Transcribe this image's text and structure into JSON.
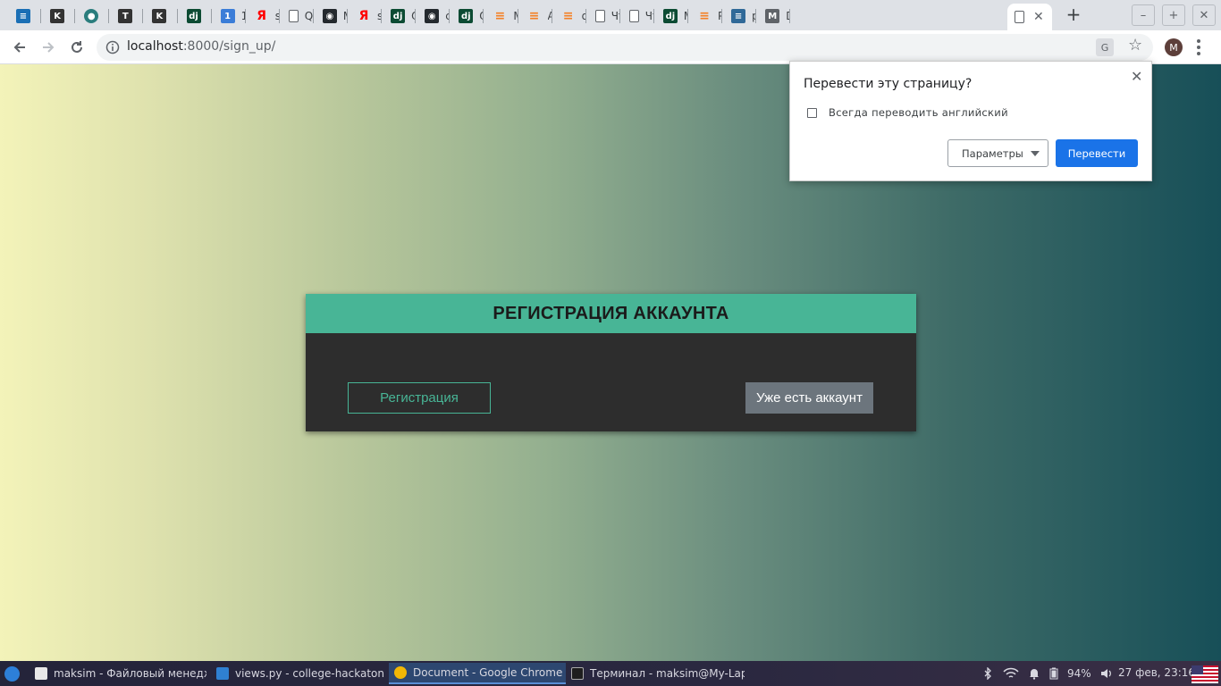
{
  "browser": {
    "tabs": [
      {
        "icon": "drive-icon",
        "icon_color": "#1a6fb5",
        "title": ""
      },
      {
        "icon": "k-icon",
        "icon_color": "#333333",
        "title": ""
      },
      {
        "icon": "circle-icon",
        "icon_color": "#2a7d7d",
        "title": ""
      },
      {
        "icon": "t-icon",
        "icon_color": "#333333",
        "title": ""
      },
      {
        "icon": "k-icon",
        "icon_color": "#333333",
        "title": ""
      },
      {
        "icon": "django-icon",
        "icon_color": "#0c4b33",
        "title": ""
      },
      {
        "icon": "one-icon",
        "icon_color": "#3b7dd8",
        "title": "1 г"
      },
      {
        "icon": "yandex-icon",
        "icon_color": "#ff0000",
        "title": "se"
      },
      {
        "icon": "page-icon",
        "icon_color": "#5f6368",
        "title": "Qt"
      },
      {
        "icon": "github-icon",
        "icon_color": "#24292e",
        "title": "Ma"
      },
      {
        "icon": "yandex-icon",
        "icon_color": "#ff0000",
        "title": "se"
      },
      {
        "icon": "django-icon",
        "icon_color": "#0c4b33",
        "title": "Qt"
      },
      {
        "icon": "github-icon",
        "icon_color": "#24292e",
        "title": "co"
      },
      {
        "icon": "django-icon",
        "icon_color": "#0c4b33",
        "title": "Qt"
      },
      {
        "icon": "stackoverflow-icon",
        "icon_color": "#f48024",
        "title": "Mo"
      },
      {
        "icon": "stackoverflow-icon",
        "icon_color": "#f48024",
        "title": "Al"
      },
      {
        "icon": "stackoverflow-icon",
        "icon_color": "#f48024",
        "title": "dja"
      },
      {
        "icon": "page-icon",
        "icon_color": "#5f6368",
        "title": "Чт"
      },
      {
        "icon": "page-icon",
        "icon_color": "#5f6368",
        "title": "Чт"
      },
      {
        "icon": "django-icon",
        "icon_color": "#0c4b33",
        "title": "Ma"
      },
      {
        "icon": "stackoverflow-icon",
        "icon_color": "#f48024",
        "title": "Py"
      },
      {
        "icon": "python-icon",
        "icon_color": "#306998",
        "title": "py"
      },
      {
        "icon": "gmail-icon",
        "icon_color": "#5f6368",
        "title": "Dj"
      }
    ],
    "active_tab": {
      "icon": "page-icon",
      "title": ""
    },
    "new_tab_symbol": "+",
    "window_buttons": {
      "minimize": "–",
      "maximize": "+",
      "close": "✕"
    },
    "url_host": "localhost",
    "url_rest": ":8000/sign_up/",
    "avatar_letter": "M"
  },
  "page": {
    "card_title": "РЕГИСТРАЦИЯ АККАУНТА",
    "register_button": "Регистрация",
    "login_button": "Уже есть аккаунт",
    "colors": {
      "accent": "#48b596",
      "card_bg": "#2d2d2d",
      "secondary_button": "#6c757d"
    }
  },
  "translate_popup": {
    "title": "Перевести эту страницу?",
    "checkbox_label": "Всегда переводить английский",
    "checkbox_checked": false,
    "options_button": "Параметры",
    "translate_button": "Перевести",
    "accent": "#1a73e8"
  },
  "taskbar": {
    "tasks": [
      {
        "icon": "home-folder-icon",
        "label": "maksim - Файловый менедж...",
        "active": false
      },
      {
        "icon": "vscode-icon",
        "label": "views.py - college-hackaton -...",
        "active": false
      },
      {
        "icon": "chrome-icon",
        "label": "Document - Google Chrome",
        "active": true
      },
      {
        "icon": "terminal-icon",
        "label": "Терминал - maksim@My-Lap...",
        "active": false
      }
    ],
    "battery_percent": "94%",
    "clock": "27 фев, 23:16"
  }
}
